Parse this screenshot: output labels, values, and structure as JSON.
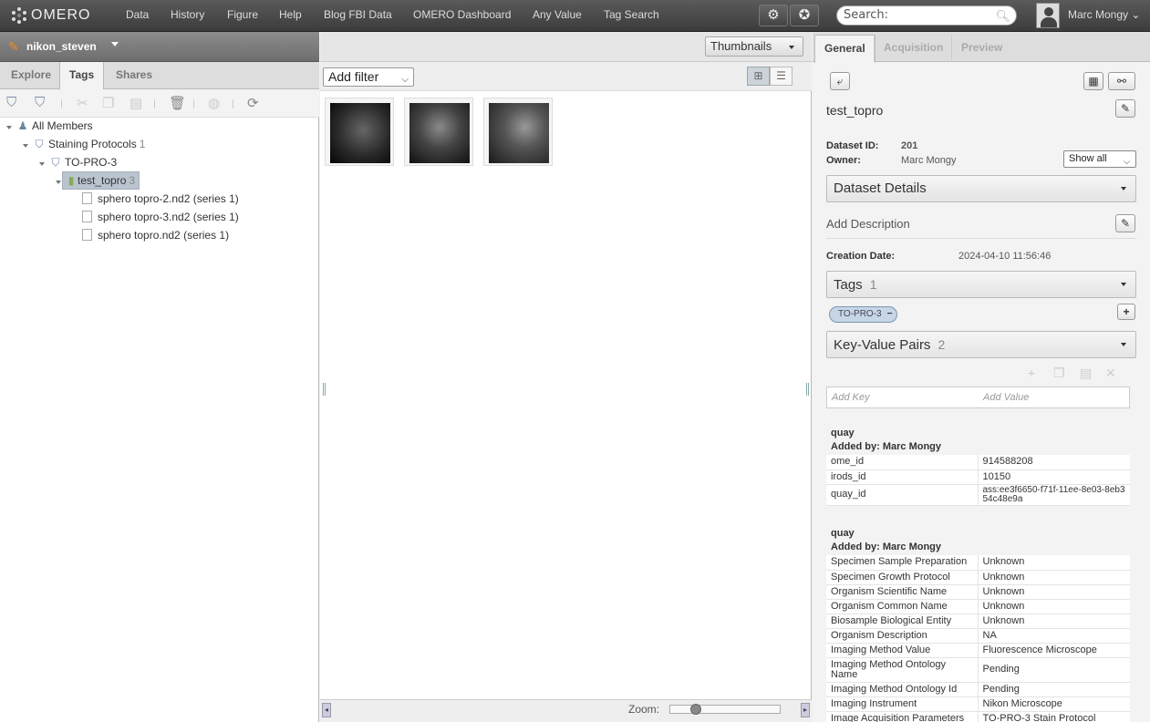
{
  "app": {
    "logo_text": "OMERO",
    "nav": [
      "Data",
      "History",
      "Figure",
      "Help",
      "Blog FBI Data",
      "OMERO Dashboard",
      "Any Value",
      "Tag Search"
    ],
    "search_placeholder": "Search:",
    "user_name": "Marc Mongy"
  },
  "left": {
    "group_name": "nikon_steven",
    "tabs": [
      "Explore",
      "Tags",
      "Shares"
    ],
    "active_tab": "Tags",
    "tree": {
      "root": "All Members",
      "tagset": {
        "label": "Staining Protocols",
        "count": "1"
      },
      "tag": {
        "label": "TO-PRO-3"
      },
      "dataset": {
        "label": "test_topro",
        "count": "3"
      },
      "images": [
        "sphero topro-2.nd2 (series 1)",
        "sphero topro-3.nd2 (series 1)",
        "sphero topro.nd2 (series 1)"
      ]
    }
  },
  "center": {
    "view_mode": "Thumbnails",
    "filter_label": "Add filter",
    "zoom_label": "Zoom:",
    "zoom_level": 0.2,
    "thumbnail_count": 3
  },
  "right": {
    "tabs": [
      "General",
      "Acquisition",
      "Preview"
    ],
    "active_tab": "General",
    "title": "test_topro",
    "dataset_id_label": "Dataset ID:",
    "dataset_id": "201",
    "owner_label": "Owner:",
    "owner": "Marc Mongy",
    "show_all": "Show all",
    "details_section": "Dataset Details",
    "add_description": "Add Description",
    "creation_date_label": "Creation Date:",
    "creation_date": "2024-04-10 11:56:46",
    "tags_section": "Tags",
    "tags_count": "1",
    "tag_pill": "TO-PRO-3",
    "tag_remove": "−",
    "kv_section": "Key-Value Pairs",
    "kv_count": "2",
    "add_key_placeholder": "Add Key",
    "add_value_placeholder": "Add Value",
    "kv_groups": [
      {
        "name": "quay",
        "added_by": "Added by: Marc Mongy",
        "rows": [
          [
            "ome_id",
            "914588208"
          ],
          [
            "irods_id",
            "10150"
          ],
          [
            "quay_id",
            "ass:ee3f6650-f71f-11ee-8e03-8eb354c48e9a"
          ]
        ]
      },
      {
        "name": "quay",
        "added_by": "Added by: Marc Mongy",
        "rows": [
          [
            "Specimen Sample Preparation",
            "Unknown"
          ],
          [
            "Specimen Growth Protocol",
            "Unknown"
          ],
          [
            "Organism Scientific Name",
            "Unknown"
          ],
          [
            "Organism Common Name",
            "Unknown"
          ],
          [
            "Biosample Biological Entity",
            "Unknown"
          ],
          [
            "Organism Description",
            "NA"
          ],
          [
            "Imaging Method Value",
            "Fluorescence Microscope"
          ],
          [
            "Imaging Method Ontology Name",
            "Pending"
          ],
          [
            "Imaging Method Ontology Id",
            "Pending"
          ],
          [
            "Imaging Instrument",
            "Nikon Microscope"
          ],
          [
            "Image Acquisition Parameters",
            "TO-PRO-3 Stain Protocol"
          ]
        ]
      }
    ]
  },
  "colors": {
    "topbar": "#4a4a4a",
    "accent_pen": "#f58a1f",
    "selection": "#bac4cf",
    "tag_pill": "#c6d6e6"
  }
}
